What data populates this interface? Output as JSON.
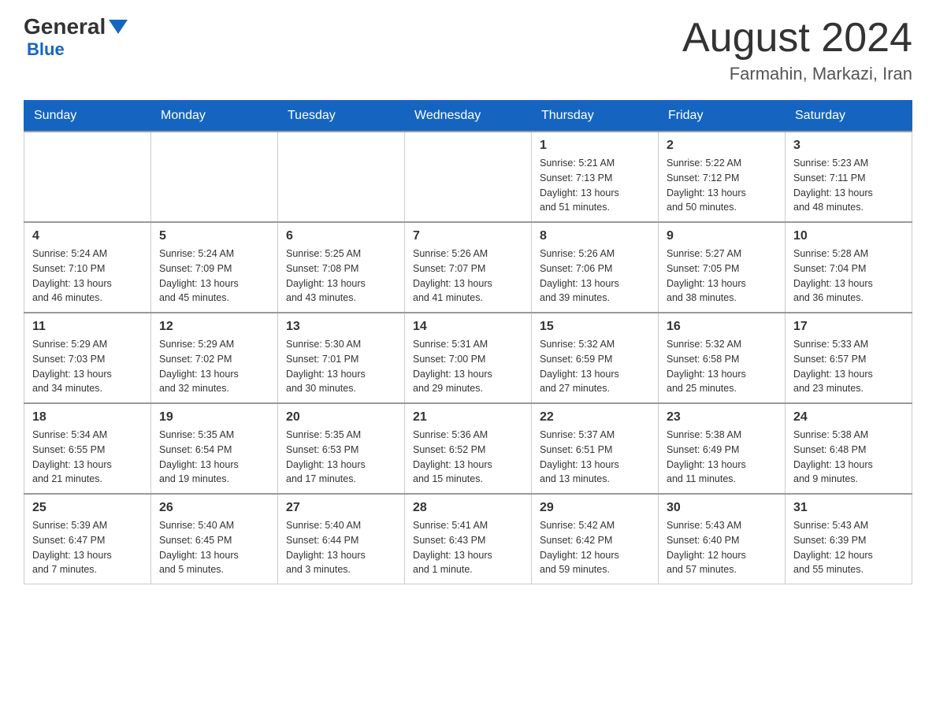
{
  "header": {
    "logo_main": "General",
    "logo_sub": "Blue",
    "month": "August 2024",
    "location": "Farmahin, Markazi, Iran"
  },
  "weekdays": [
    "Sunday",
    "Monday",
    "Tuesday",
    "Wednesday",
    "Thursday",
    "Friday",
    "Saturday"
  ],
  "weeks": [
    [
      {
        "day": "",
        "info": ""
      },
      {
        "day": "",
        "info": ""
      },
      {
        "day": "",
        "info": ""
      },
      {
        "day": "",
        "info": ""
      },
      {
        "day": "1",
        "info": "Sunrise: 5:21 AM\nSunset: 7:13 PM\nDaylight: 13 hours\nand 51 minutes."
      },
      {
        "day": "2",
        "info": "Sunrise: 5:22 AM\nSunset: 7:12 PM\nDaylight: 13 hours\nand 50 minutes."
      },
      {
        "day": "3",
        "info": "Sunrise: 5:23 AM\nSunset: 7:11 PM\nDaylight: 13 hours\nand 48 minutes."
      }
    ],
    [
      {
        "day": "4",
        "info": "Sunrise: 5:24 AM\nSunset: 7:10 PM\nDaylight: 13 hours\nand 46 minutes."
      },
      {
        "day": "5",
        "info": "Sunrise: 5:24 AM\nSunset: 7:09 PM\nDaylight: 13 hours\nand 45 minutes."
      },
      {
        "day": "6",
        "info": "Sunrise: 5:25 AM\nSunset: 7:08 PM\nDaylight: 13 hours\nand 43 minutes."
      },
      {
        "day": "7",
        "info": "Sunrise: 5:26 AM\nSunset: 7:07 PM\nDaylight: 13 hours\nand 41 minutes."
      },
      {
        "day": "8",
        "info": "Sunrise: 5:26 AM\nSunset: 7:06 PM\nDaylight: 13 hours\nand 39 minutes."
      },
      {
        "day": "9",
        "info": "Sunrise: 5:27 AM\nSunset: 7:05 PM\nDaylight: 13 hours\nand 38 minutes."
      },
      {
        "day": "10",
        "info": "Sunrise: 5:28 AM\nSunset: 7:04 PM\nDaylight: 13 hours\nand 36 minutes."
      }
    ],
    [
      {
        "day": "11",
        "info": "Sunrise: 5:29 AM\nSunset: 7:03 PM\nDaylight: 13 hours\nand 34 minutes."
      },
      {
        "day": "12",
        "info": "Sunrise: 5:29 AM\nSunset: 7:02 PM\nDaylight: 13 hours\nand 32 minutes."
      },
      {
        "day": "13",
        "info": "Sunrise: 5:30 AM\nSunset: 7:01 PM\nDaylight: 13 hours\nand 30 minutes."
      },
      {
        "day": "14",
        "info": "Sunrise: 5:31 AM\nSunset: 7:00 PM\nDaylight: 13 hours\nand 29 minutes."
      },
      {
        "day": "15",
        "info": "Sunrise: 5:32 AM\nSunset: 6:59 PM\nDaylight: 13 hours\nand 27 minutes."
      },
      {
        "day": "16",
        "info": "Sunrise: 5:32 AM\nSunset: 6:58 PM\nDaylight: 13 hours\nand 25 minutes."
      },
      {
        "day": "17",
        "info": "Sunrise: 5:33 AM\nSunset: 6:57 PM\nDaylight: 13 hours\nand 23 minutes."
      }
    ],
    [
      {
        "day": "18",
        "info": "Sunrise: 5:34 AM\nSunset: 6:55 PM\nDaylight: 13 hours\nand 21 minutes."
      },
      {
        "day": "19",
        "info": "Sunrise: 5:35 AM\nSunset: 6:54 PM\nDaylight: 13 hours\nand 19 minutes."
      },
      {
        "day": "20",
        "info": "Sunrise: 5:35 AM\nSunset: 6:53 PM\nDaylight: 13 hours\nand 17 minutes."
      },
      {
        "day": "21",
        "info": "Sunrise: 5:36 AM\nSunset: 6:52 PM\nDaylight: 13 hours\nand 15 minutes."
      },
      {
        "day": "22",
        "info": "Sunrise: 5:37 AM\nSunset: 6:51 PM\nDaylight: 13 hours\nand 13 minutes."
      },
      {
        "day": "23",
        "info": "Sunrise: 5:38 AM\nSunset: 6:49 PM\nDaylight: 13 hours\nand 11 minutes."
      },
      {
        "day": "24",
        "info": "Sunrise: 5:38 AM\nSunset: 6:48 PM\nDaylight: 13 hours\nand 9 minutes."
      }
    ],
    [
      {
        "day": "25",
        "info": "Sunrise: 5:39 AM\nSunset: 6:47 PM\nDaylight: 13 hours\nand 7 minutes."
      },
      {
        "day": "26",
        "info": "Sunrise: 5:40 AM\nSunset: 6:45 PM\nDaylight: 13 hours\nand 5 minutes."
      },
      {
        "day": "27",
        "info": "Sunrise: 5:40 AM\nSunset: 6:44 PM\nDaylight: 13 hours\nand 3 minutes."
      },
      {
        "day": "28",
        "info": "Sunrise: 5:41 AM\nSunset: 6:43 PM\nDaylight: 13 hours\nand 1 minute."
      },
      {
        "day": "29",
        "info": "Sunrise: 5:42 AM\nSunset: 6:42 PM\nDaylight: 12 hours\nand 59 minutes."
      },
      {
        "day": "30",
        "info": "Sunrise: 5:43 AM\nSunset: 6:40 PM\nDaylight: 12 hours\nand 57 minutes."
      },
      {
        "day": "31",
        "info": "Sunrise: 5:43 AM\nSunset: 6:39 PM\nDaylight: 12 hours\nand 55 minutes."
      }
    ]
  ]
}
